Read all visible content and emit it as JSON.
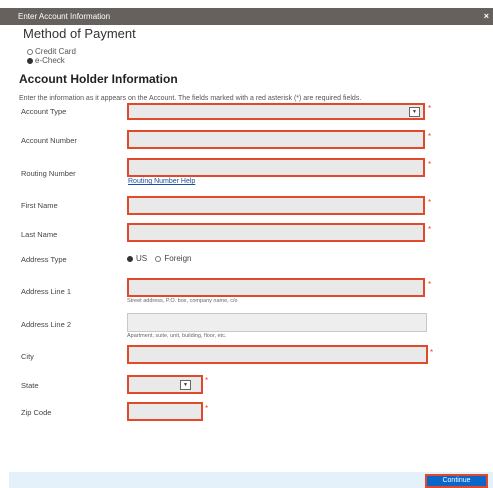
{
  "dialog": {
    "title": "Enter Account Information",
    "close_glyph": "×"
  },
  "payment": {
    "heading": "Method of Payment",
    "options": [
      {
        "label": "Credit Card",
        "selected": false
      },
      {
        "label": "e-Check",
        "selected": true
      }
    ]
  },
  "account_holder": {
    "heading": "Account Holder Information",
    "instructions": "Enter the information as it appears on the Account. The fields marked with a red asterisk (*) are required fields."
  },
  "fields": {
    "account_type": {
      "label": "Account Type"
    },
    "account_number": {
      "label": "Account Number"
    },
    "routing_number": {
      "label": "Routing Number",
      "help": "Routing Number Help"
    },
    "first_name": {
      "label": "First Name"
    },
    "last_name": {
      "label": "Last Name"
    },
    "address_type": {
      "label": "Address Type",
      "options": [
        "US",
        "Foreign"
      ],
      "selected": "US"
    },
    "address_line_1": {
      "label": "Address Line 1",
      "hint": "Street address, P.O. box, company name, c/o"
    },
    "address_line_2": {
      "label": "Address Line 2",
      "hint": "Apartment, suite, unit, building, floor, etc."
    },
    "city": {
      "label": "City"
    },
    "state": {
      "label": "State"
    },
    "zip": {
      "label": "Zip Code"
    }
  },
  "required_mark": "*",
  "footer": {
    "continue_label": "Continue"
  },
  "colors": {
    "highlight": "#e0492a",
    "titlebar": "#66615d",
    "button": "#0b66c9",
    "footer_bg": "#e4f1fb"
  },
  "icons": {
    "select_arrow": "chevron-down-icon",
    "close": "close-icon"
  }
}
